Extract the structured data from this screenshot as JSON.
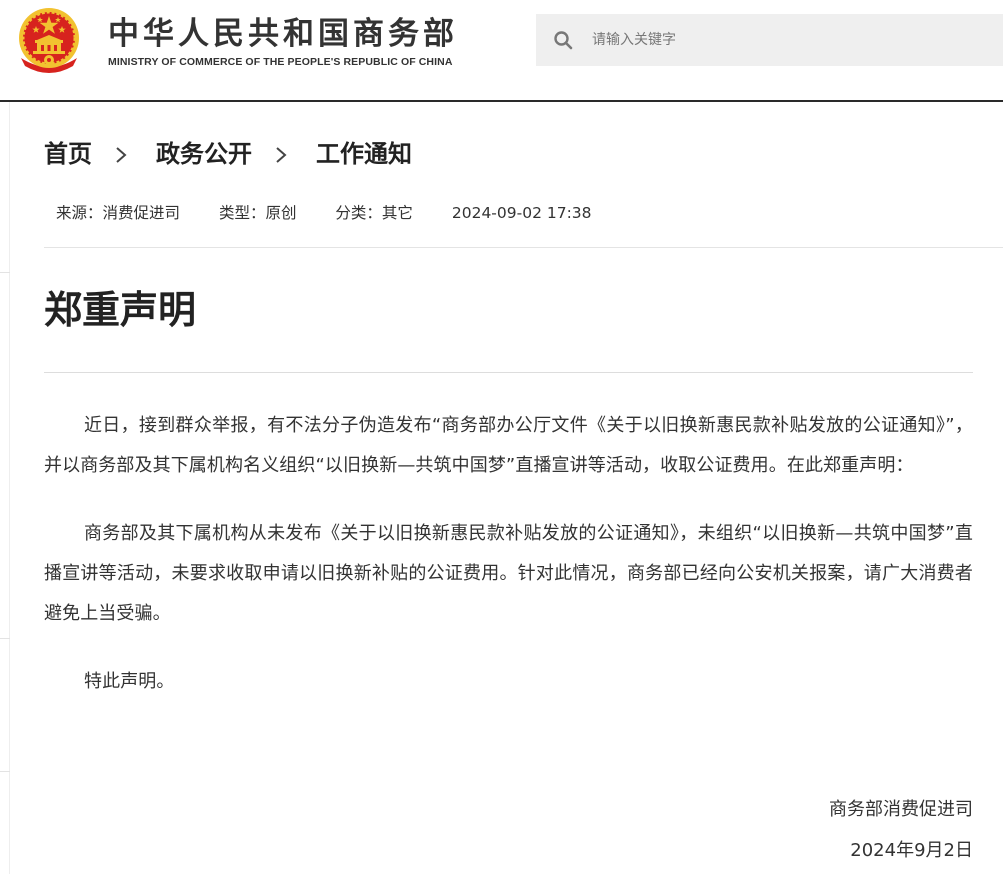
{
  "header": {
    "site_title_cn": "中华人民共和国商务部",
    "site_title_en": "MINISTRY OF COMMERCE OF THE PEOPLE'S REPUBLIC OF CHINA",
    "emblem_icon": "national-emblem-icon"
  },
  "search": {
    "placeholder": "请输入关键字",
    "value": "",
    "icon": "search-icon"
  },
  "breadcrumb": {
    "items": [
      "首页",
      "政务公开",
      "工作通知"
    ],
    "separator_icon": "chevron-right-icon"
  },
  "meta": {
    "source": "来源：消费促进司",
    "type": "类型：原创",
    "category": "分类：其它",
    "datetime": "2024-09-02 17:38"
  },
  "article": {
    "title": "郑重声明",
    "paragraphs": [
      "近日，接到群众举报，有不法分子伪造发布“商务部办公厅文件《关于以旧换新惠民款补贴发放的公证通知》”，并以商务部及其下属机构名义组织“以旧换新—共筑中国梦”直播宣讲等活动，收取公证费用。在此郑重声明：",
      "商务部及其下属机构从未发布《关于以旧换新惠民款补贴发放的公证通知》，未组织“以旧换新—共筑中国梦”直播宣讲等活动，未要求收取申请以旧换新补贴的公证费用。针对此情况，商务部已经向公安机关报案，请广大消费者避免上当受骗。",
      "特此声明。"
    ],
    "signature": "商务部消费促进司",
    "date": "2024年9月2日"
  },
  "colors": {
    "emblem_red": "#d7231e",
    "emblem_gold": "#f2c230",
    "text": "#333333",
    "search_bg": "#efefef"
  }
}
